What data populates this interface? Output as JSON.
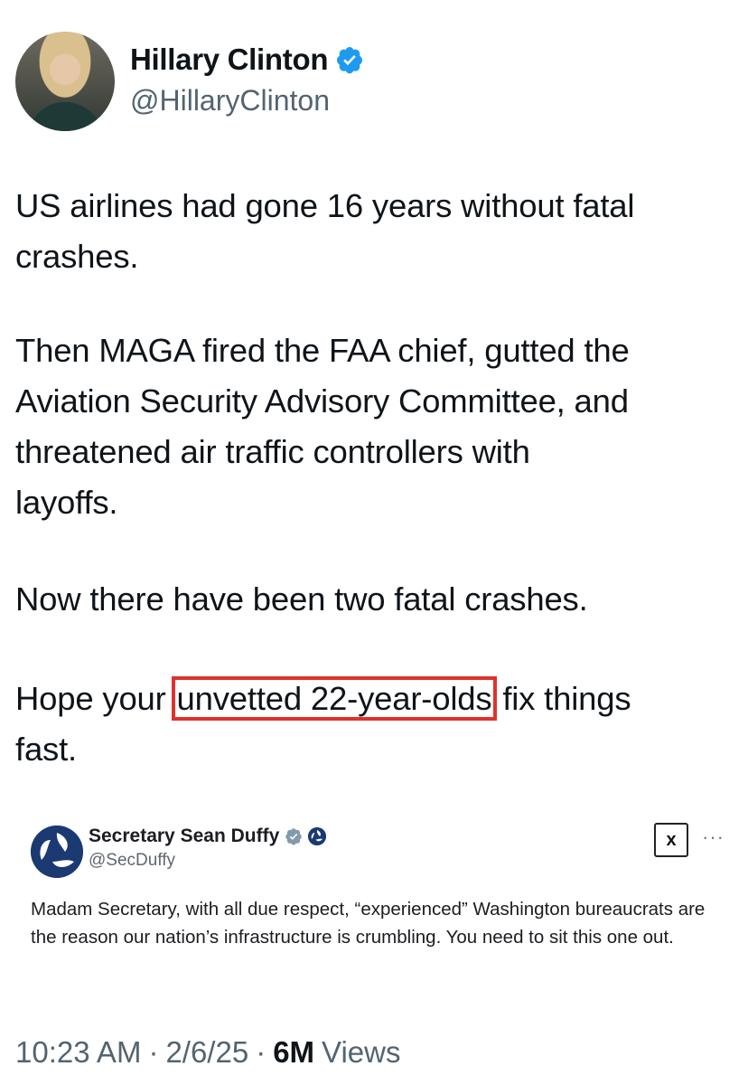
{
  "author": {
    "name": "Hillary Clinton",
    "handle": "@HillaryClinton",
    "verified_color": "#1d9bf0"
  },
  "tweet": {
    "paragraphs": [
      "US airlines had gone 16 years without fatal\ncrashes.",
      "Then MAGA fired the FAA chief, gutted the\nAviation Security Advisory Committee, and\nthreatened air traffic controllers with\nlayoffs.",
      "Now there have been two fatal crashes."
    ],
    "last_paragraph": {
      "before": "Hope your ",
      "highlighted": "unvetted 22-year-olds",
      "after": " fix things\nfast."
    },
    "highlight_color": "#e0312b"
  },
  "quoted": {
    "name": "Secretary Sean Duffy",
    "handle": "@SecDuffy",
    "xai_label": "x",
    "more_label": "···",
    "text": "Madam Secretary, with all due respect, “experienced” Washington bureaucrats are the reason our nation’s infrastructure is crumbling. You need to sit this one out."
  },
  "footer": {
    "time": "10:23 AM",
    "date": "2/6/25",
    "views_count": "6M",
    "views_label": "Views"
  }
}
